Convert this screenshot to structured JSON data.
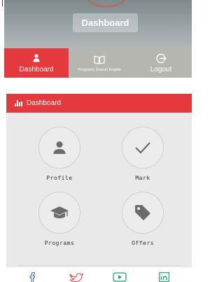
{
  "header": {
    "title": "Dashboard"
  },
  "tabs": [
    {
      "label": "Dashboard",
      "icon": "user-icon",
      "active": true
    },
    {
      "label": "Programs Search Engine",
      "icon": "book-icon",
      "active": false
    },
    {
      "label": "Logout",
      "icon": "logout-icon",
      "active": false
    }
  ],
  "panel": {
    "title": "Dashboard",
    "icon": "bar-chart-icon"
  },
  "cards": [
    {
      "label": "Profile",
      "icon": "person-icon"
    },
    {
      "label": "Mark",
      "icon": "checkmark-icon"
    },
    {
      "label": "Programs",
      "icon": "graduation-cap-icon"
    },
    {
      "label": "Offers",
      "icon": "tag-icon"
    }
  ],
  "social": [
    {
      "name": "facebook-icon",
      "color": "#3b6fc2"
    },
    {
      "name": "twitter-icon",
      "color": "#e53a3d"
    },
    {
      "name": "youtube-icon",
      "color": "#1aa37a"
    },
    {
      "name": "linkedin-icon",
      "color": "#1aa37a"
    }
  ],
  "colors": {
    "accent": "#e53a3d",
    "tabbar": "#b6b6b0",
    "panel_bg": "#e9e9e9",
    "icon_gray": "#6b6b6b"
  }
}
